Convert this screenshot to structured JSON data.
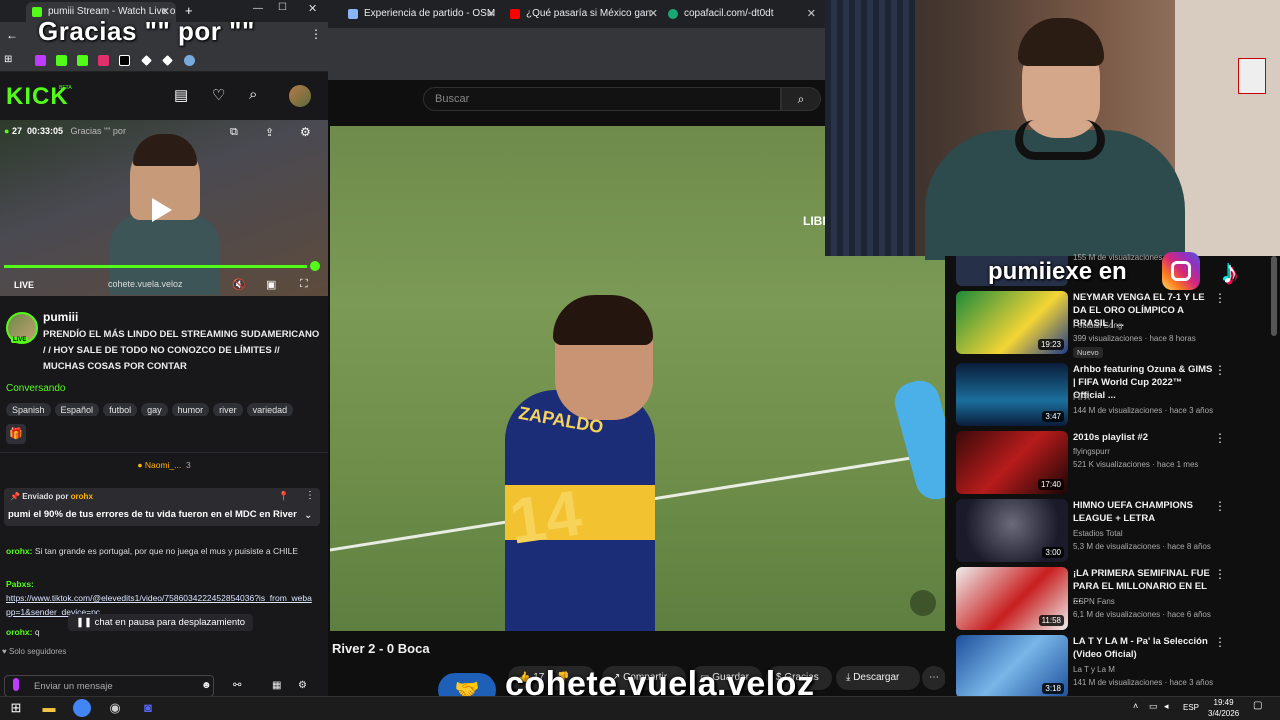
{
  "kick_browser": {
    "active_tab": "pumiii Stream - Watch Live on Ki",
    "overlay_title": "Gracias \"\" por \"\"",
    "bookmark_colors": [
      "#bf3cff",
      "#53fc18",
      "#53fc18",
      "#e1306c",
      "#ffffff",
      "#ffffff",
      "#ffffff",
      "#7ad"
    ]
  },
  "kick": {
    "logo": "KICK",
    "beta": "BETA",
    "player": {
      "viewers": "27",
      "uptime": "00:33:05",
      "overlay_title_small": "Gracias \"\" por",
      "live_label": "LIVE",
      "watermark": "cohete.vuela.veloz",
      "progress_pct": 97
    },
    "streamer": {
      "name": "pumiii",
      "live_badge": "LIVE",
      "title": "PRENDÍO EL MÁS LINDO DEL STREAMING SUDAMERICANO / / HOY SALE DE TODO NO CONOZCO DE LÍMITES // MUCHAS COSAS POR CONTAR",
      "category": "Conversando",
      "tags": [
        "Spanish",
        "Español",
        "futbol",
        "gay",
        "humor",
        "river",
        "variedad"
      ]
    },
    "chat": {
      "gifter_name": "Naomi_...",
      "gifter_count": "3",
      "pinned_prefix": "Enviado por",
      "pinned_user": "orohx",
      "pinned_text": "pumi el 90% de tus errores de tu vida fueron en el MDC en River",
      "messages": [
        {
          "user": "orohx:",
          "text": "Si tan grande es portugal, por que no juega el mus y puisiste a CHILE"
        },
        {
          "user": "Pabxs:",
          "text": ""
        },
        {
          "user": "",
          "link": "https://www.tiktok.com/@elevedits1/video/7586034222452854036?is_from_webapp=1&sender_device=pc"
        },
        {
          "user": "orohx:",
          "text": "q"
        }
      ],
      "paused_label": "chat en pausa para desplazamiento",
      "followers_only": "Solo seguidores",
      "input_placeholder": "Enviar un mensaje"
    }
  },
  "right_browser": {
    "tabs": [
      {
        "label": "Experiencia de partido - OSM"
      },
      {
        "label": "¿Qué pasaría si México gan"
      },
      {
        "label": "copafacil.com/-dt0dt"
      }
    ]
  },
  "youtube": {
    "search_placeholder": "Buscar",
    "video_title": "River 2 - 0 Boca",
    "video_overlay_text": "LIBI",
    "player_shirt_text": "ZAPALDO",
    "player_number": "14",
    "actions": {
      "likes": "17",
      "share": "Compartir",
      "save": "Guardar",
      "thanks": "Gracias",
      "download": "Descargar"
    },
    "sidebar_top_meta": "155 M de visualizaciones",
    "recommendations": [
      {
        "title": "NEYMAR VENGA EL 7-1 Y LE DA EL ORO OLÍMPICO A BRASIL | ...",
        "channel": "Football Song",
        "meta": "399 visualizaciones · hace 8 horas",
        "duration": "19:23",
        "badge": "Nuevo"
      },
      {
        "title": "Arhbo featuring Ozuna & GIMS | FIFA World Cup 2022™ Official ...",
        "channel": "FIFA",
        "meta": "144 M de visualizaciones · hace 3 años",
        "duration": "3:47"
      },
      {
        "title": "2010s playlist #2",
        "channel": "flyingspurr",
        "meta": "521 K visualizaciones · hace 1 mes",
        "duration": "17:40"
      },
      {
        "title": "HIMNO UEFA CHAMPIONS LEAGUE + LETRA",
        "channel": "Estadios Total",
        "meta": "5,3 M de visualizaciones · hace 8 años",
        "duration": "3:00"
      },
      {
        "title": "¡LA PRIMERA SEMIFINAL FUE PARA EL MILLONARIO EN EL ...",
        "channel": "ESPN Fans",
        "meta": "6,1 M de visualizaciones · hace 6 años",
        "duration": "11:58"
      },
      {
        "title": "LA T Y LA M - Pa' la Selección (Video Oficial)",
        "channel": "La T y La M",
        "meta": "141 M de visualizaciones · hace 3 años",
        "duration": "3:18"
      }
    ]
  },
  "overlays": {
    "instagram_text": "pumiiexe en",
    "bottom_handle": "cohete.vuela.veloz"
  },
  "taskbar": {
    "time": "19:49",
    "date": "3/4/2026",
    "lang": "ESP"
  }
}
